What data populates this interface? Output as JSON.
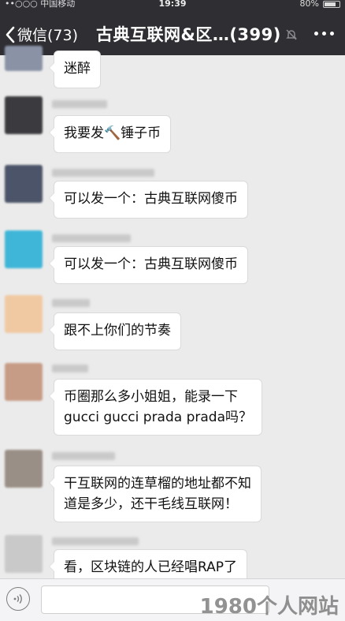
{
  "status": {
    "carrier": "••○○○ 中国移动",
    "time": "19:39",
    "battery": "80%",
    "battery_level": 0.8
  },
  "nav": {
    "back_label": "微信(73)",
    "title": "古典互联网&区…(399)"
  },
  "messages": [
    {
      "text_lines": [
        "迷醉"
      ],
      "avatar_color": "#8a93a6"
    },
    {
      "text_lines": [
        "我要发🔨锤子币"
      ],
      "avatar_color": "#3b3b3f"
    },
    {
      "text_lines": [
        "可以发一个：古典互联网傻币"
      ],
      "avatar_color": "#4b5468"
    },
    {
      "text_lines": [
        "可以发一个：古典互联网傻币"
      ],
      "avatar_color": "#3fb6d8"
    },
    {
      "text_lines": [
        "跟不上你们的节奏"
      ],
      "avatar_color": "#f0c9a2"
    },
    {
      "text_lines": [
        "币圈那么多小姐姐，能录一下",
        "gucci gucci prada prada吗？"
      ],
      "avatar_color": "#c79c86"
    },
    {
      "text_lines": [
        "干互联网的连草榴的地址都不知",
        "道是多少，还干毛线互联网！"
      ],
      "avatar_color": "#9a8f86"
    },
    {
      "text_lines": [
        "看，区块链的人已经唱RAP了"
      ],
      "avatar_color": "#c9c9c9"
    }
  ],
  "watermark": "1980个人网站"
}
